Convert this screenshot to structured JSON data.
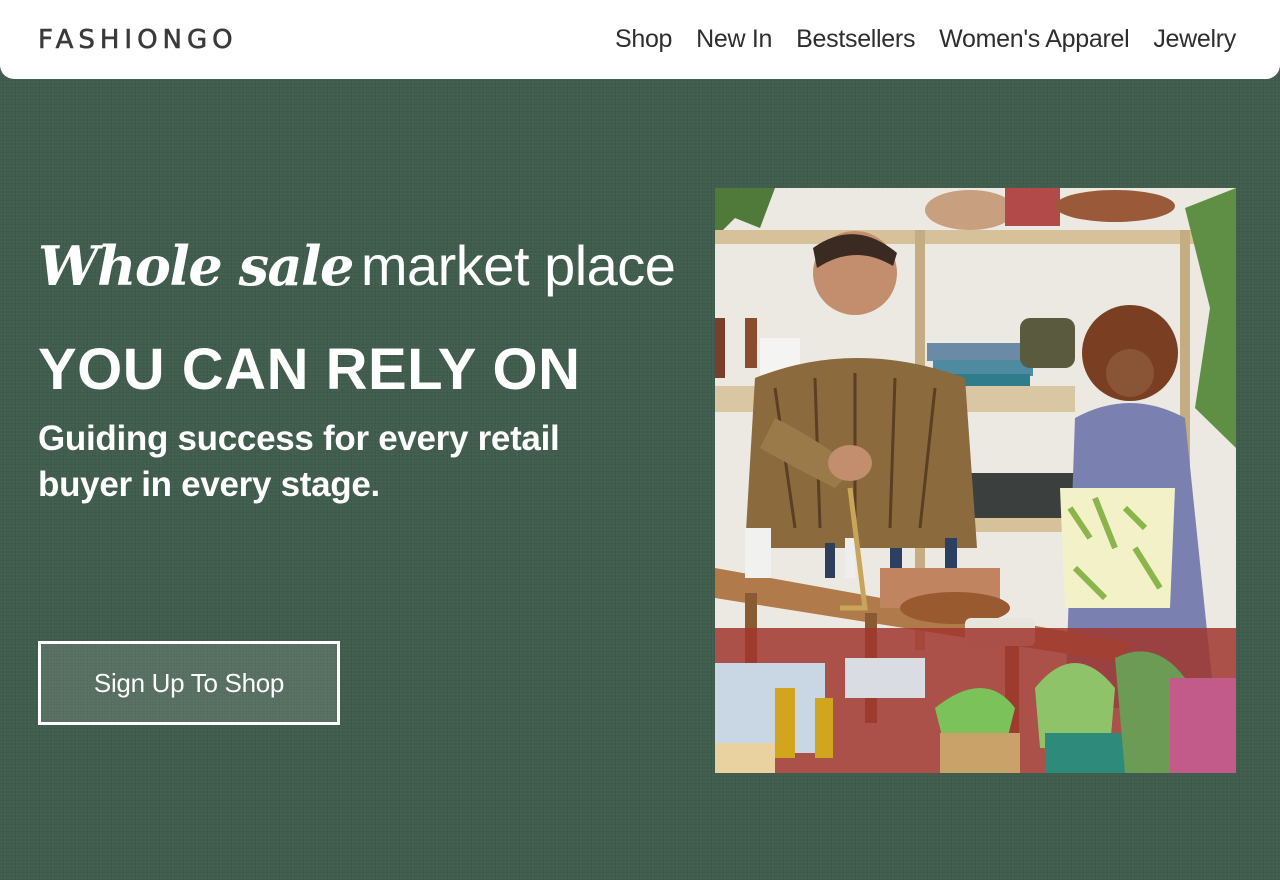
{
  "header": {
    "logo": "FASHIONGO",
    "nav": [
      "Shop",
      "New In",
      "Bestsellers",
      "Women's Apparel",
      "Jewelry"
    ]
  },
  "hero": {
    "tagline_italic": "Whole sale",
    "tagline_light": "market place",
    "headline": "YOU CAN RELY ON",
    "subline": "Guiding success for every retail buyer in every stage.",
    "cta_label": "Sign Up To Shop",
    "image_icon": "shop-photo-icon"
  },
  "colors": {
    "background": "#3f5c4c",
    "header_bg": "#ffffff",
    "text_light": "#ffffff",
    "nav_text": "#2e2e2e"
  }
}
